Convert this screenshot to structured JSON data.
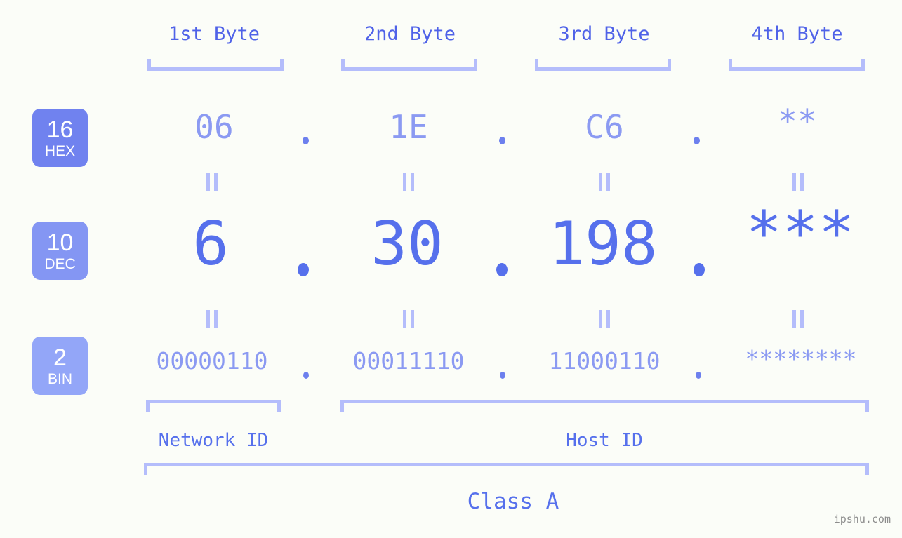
{
  "watermark": "ipshu.com",
  "colors": {
    "background": "#fbfdf8",
    "accent_dark": "#5670ec",
    "accent_mid": "#8b9af2",
    "accent_light": "#b4bdfb",
    "badge_hex": "#7082ef",
    "badge_dec": "#8496f3",
    "badge_bin": "#93a6f8",
    "watermark": "#8d8d8d"
  },
  "byte_headers": [
    {
      "label": "1st Byte"
    },
    {
      "label": "2nd Byte"
    },
    {
      "label": "3rd Byte"
    },
    {
      "label": "4th Byte"
    }
  ],
  "bases": [
    {
      "id": "hex",
      "number": "16",
      "name": "HEX"
    },
    {
      "id": "dec",
      "number": "10",
      "name": "DEC"
    },
    {
      "id": "bin",
      "number": "2",
      "name": "BIN"
    }
  ],
  "rows": {
    "hex": {
      "base_number": "16",
      "base_name": "HEX",
      "values": [
        "06",
        "1E",
        "C6",
        "**"
      ],
      "separators": [
        ".",
        ".",
        "."
      ]
    },
    "dec": {
      "base_number": "10",
      "base_name": "DEC",
      "values": [
        "6",
        "30",
        "198",
        "***"
      ],
      "separators": [
        ".",
        ".",
        "."
      ]
    },
    "bin": {
      "base_number": "2",
      "base_name": "BIN",
      "values": [
        "00000110",
        "00011110",
        "11000110",
        "********"
      ],
      "separators": [
        ".",
        ".",
        "."
      ]
    }
  },
  "connectors": {
    "symbol": "=",
    "count_per_gap": 4,
    "gaps": [
      "hex-to-dec",
      "dec-to-bin"
    ]
  },
  "sections": {
    "network_id": {
      "label": "Network ID",
      "spans_bytes": [
        1
      ]
    },
    "host_id": {
      "label": "Host ID",
      "spans_bytes": [
        2,
        3,
        4
      ]
    },
    "class": {
      "label": "Class A",
      "spans_bytes": [
        1,
        2,
        3,
        4
      ]
    }
  }
}
